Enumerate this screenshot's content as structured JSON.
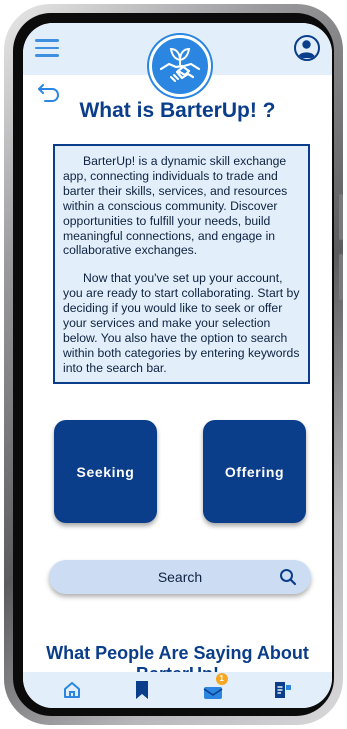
{
  "header": {
    "menu_icon": "hamburger-menu-icon",
    "profile_icon": "user-circle-icon",
    "logo_icon": "handshake-sprout-logo"
  },
  "page": {
    "back_icon": "undo-arrow-icon",
    "title": "What is BarterUp! ?",
    "intro_paragraph": "BarterUp! is a dynamic skill exchange app, connecting individuals to trade and barter their skills, services, and resources within a conscious community. Discover opportunities to fulfill your needs, build meaningful connections, and engage in collaborative exchanges.",
    "instructions_paragraph": "Now that you've set up your account, you are ready to start collaborating. Start by deciding if you would like to seek or offer your services and make your selection below. You also have the option to search within both categories by entering keywords into the search bar."
  },
  "choices": {
    "seeking_label": "Seeking",
    "offering_label": "Offering"
  },
  "search": {
    "placeholder": "Search",
    "icon": "search-icon"
  },
  "testimonials": {
    "title": "What People Are Saying About BarterUp!"
  },
  "bottom_nav": {
    "items": [
      {
        "icon": "home-icon"
      },
      {
        "icon": "bookmark-icon"
      },
      {
        "icon": "inbox-icon",
        "badge": "1"
      },
      {
        "icon": "document-icon"
      }
    ]
  },
  "colors": {
    "primary": "#0a3d8a",
    "accent": "#2a86e0",
    "light_bg": "#e2eefa",
    "search_bg": "#ccdcf2",
    "badge": "#f5a623"
  }
}
